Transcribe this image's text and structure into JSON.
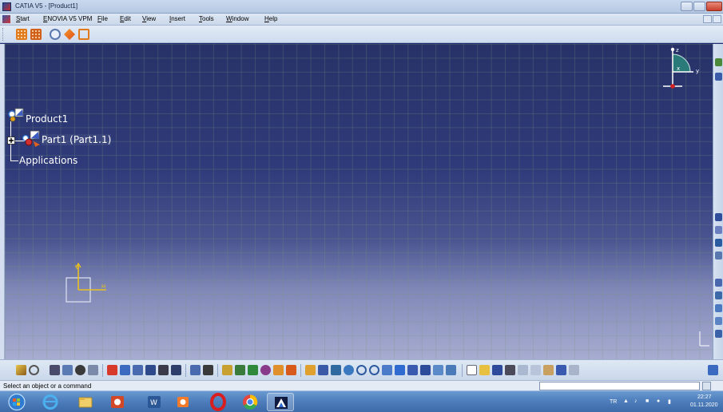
{
  "window": {
    "title": "CATIA V5 - [Product1]"
  },
  "menubar": {
    "items": [
      "Start",
      "ENOVIA V5 VPM",
      "File",
      "Edit",
      "View",
      "Insert",
      "Tools",
      "Window",
      "Help"
    ]
  },
  "tree": {
    "root": "Product1",
    "child": "Part1 (Part1.1)",
    "applications": "Applications"
  },
  "compass": {
    "axes": [
      "z",
      "x",
      "y"
    ]
  },
  "axis_system": {
    "v_label": "V",
    "h_label": "H"
  },
  "status": {
    "message": "Select an object or a command",
    "command_input_value": ""
  },
  "taskbar": {
    "apps": [
      "start-orb",
      "internet-explorer",
      "file-explorer",
      "powerpoint",
      "word",
      "media-player",
      "opera",
      "chrome",
      "catia"
    ],
    "language": "TR",
    "time": "22:27",
    "date": "01.11.2020"
  },
  "colors": {
    "viewport_top": "#283268",
    "viewport_bottom": "#a7acd0",
    "grid": "#789678",
    "titlebar": "#c9d9ee"
  }
}
